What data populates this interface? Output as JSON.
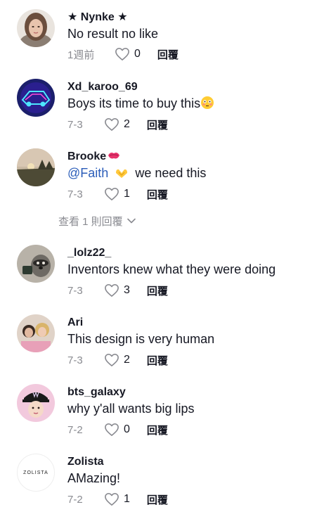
{
  "comments": [
    {
      "username": "★ Nynke ★",
      "text": "No result no like",
      "date": "1週前",
      "likes": "0",
      "reply": "回覆",
      "avatar": "woman-portrait"
    },
    {
      "username": "Xd_karoo_69",
      "text": "Boys its time to buy this",
      "emoji": "flushed-face-emoji",
      "date": "7-3",
      "likes": "2",
      "reply": "回覆",
      "avatar": "neon-car-logo"
    },
    {
      "username": "Brooke",
      "username_emoji": "kiss-mark-emoji",
      "mention": "@Faith",
      "text": "we need this",
      "emoji": "heart-hands-emoji",
      "date": "7-3",
      "likes": "1",
      "reply": "回覆",
      "avatar": "sunset-landscape"
    },
    {
      "username": "_lolz22_",
      "text": "Inventors knew what they were doing",
      "date": "7-3",
      "likes": "3",
      "reply": "回覆",
      "avatar": "raccoon-photo"
    },
    {
      "username": "Ari",
      "text": "This design is very human",
      "date": "7-3",
      "likes": "2",
      "reply": "回覆",
      "avatar": "friends-photo"
    },
    {
      "username": "bts_galaxy",
      "text": "why y'all wants big lips",
      "date": "7-2",
      "likes": "0",
      "reply": "回覆",
      "avatar": "bts-cap-character"
    },
    {
      "username": "Zolista",
      "text": "AMazing!",
      "date": "7-2",
      "likes": "1",
      "reply": "回覆",
      "avatar": "zolista-logo",
      "avatar_text": "ZOLISTA"
    }
  ],
  "view_replies": {
    "label": "查看 1 則回覆",
    "icon": "chevron-down-icon"
  },
  "colors": {
    "text": "#161823",
    "muted": "#8a8b91",
    "mention": "#2b5db9"
  }
}
